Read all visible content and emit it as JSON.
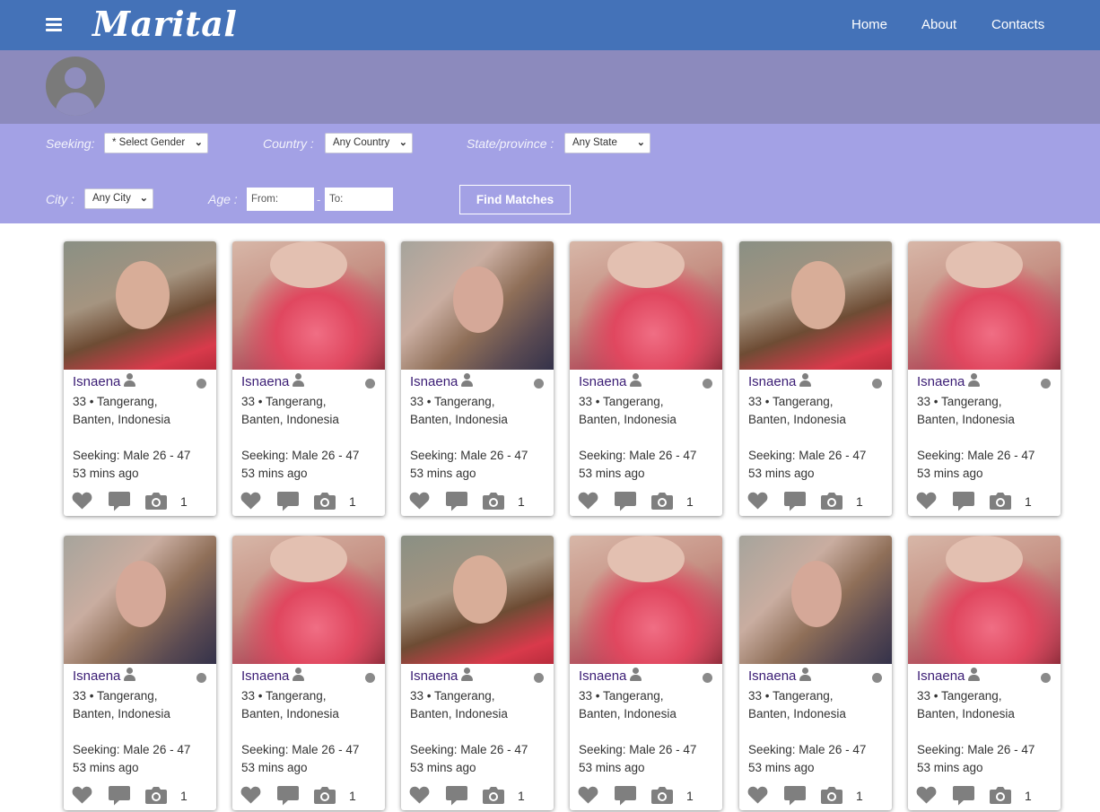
{
  "app": {
    "logo": "Marital",
    "nav": [
      {
        "label": "Home"
      },
      {
        "label": "About"
      },
      {
        "label": "Contacts"
      }
    ]
  },
  "filters": {
    "seeking_label": "Seeking:",
    "gender_value": "* Select Gender",
    "country_label": "Country :",
    "country_value": "Any Country",
    "state_label": "State/province :",
    "state_value": "Any State",
    "city_label": "City :",
    "city_value": "Any City",
    "age_label": "Age :",
    "age_from_placeholder": "From:",
    "age_to_placeholder": "To:",
    "age_separator": "-",
    "find_button": "Find Matches"
  },
  "profiles": [
    {
      "name": "Isnaena",
      "location_line1": "33 • Tangerang,",
      "location_line2": "Banten, Indonesia",
      "seeking_label": "Seeking:",
      "seeking_value": " Male 26 - 47",
      "last_seen": "53 mins ago",
      "photo_count": "1",
      "photo_style": "smile"
    },
    {
      "name": "Isnaena",
      "location_line1": "33 • Tangerang,",
      "location_line2": "Banten, Indonesia",
      "seeking_label": "Seeking:",
      "seeking_value": " Male 26 - 47",
      "last_seen": "53 mins ago",
      "photo_count": "1",
      "photo_style": "flowers"
    },
    {
      "name": "Isnaena",
      "location_line1": "33 • Tangerang,",
      "location_line2": "Banten, Indonesia",
      "seeking_label": "Seeking:",
      "seeking_value": " Male 26 - 47",
      "last_seen": "53 mins ago",
      "photo_count": "1",
      "photo_style": "profile"
    },
    {
      "name": "Isnaena",
      "location_line1": "33 • Tangerang,",
      "location_line2": "Banten, Indonesia",
      "seeking_label": "Seeking:",
      "seeking_value": " Male 26 - 47",
      "last_seen": "53 mins ago",
      "photo_count": "1",
      "photo_style": "flowers"
    },
    {
      "name": "Isnaena",
      "location_line1": "33 • Tangerang,",
      "location_line2": "Banten, Indonesia",
      "seeking_label": "Seeking:",
      "seeking_value": " Male 26 - 47",
      "last_seen": "53 mins ago",
      "photo_count": "1",
      "photo_style": "smile"
    },
    {
      "name": "Isnaena",
      "location_line1": "33 • Tangerang,",
      "location_line2": "Banten, Indonesia",
      "seeking_label": "Seeking:",
      "seeking_value": " Male 26 - 47",
      "last_seen": "53 mins ago",
      "photo_count": "1",
      "photo_style": "flowers"
    },
    {
      "name": "Isnaena",
      "location_line1": "33 • Tangerang,",
      "location_line2": "Banten, Indonesia",
      "seeking_label": "Seeking:",
      "seeking_value": " Male 26 - 47",
      "last_seen": "53 mins ago",
      "photo_count": "1",
      "photo_style": "profile"
    },
    {
      "name": "Isnaena",
      "location_line1": "33 • Tangerang,",
      "location_line2": "Banten, Indonesia",
      "seeking_label": "Seeking:",
      "seeking_value": " Male 26 - 47",
      "last_seen": "53 mins ago",
      "photo_count": "1",
      "photo_style": "flowers"
    },
    {
      "name": "Isnaena",
      "location_line1": "33 • Tangerang,",
      "location_line2": "Banten, Indonesia",
      "seeking_label": "Seeking:",
      "seeking_value": " Male 26 - 47",
      "last_seen": "53 mins ago",
      "photo_count": "1",
      "photo_style": "smile"
    },
    {
      "name": "Isnaena",
      "location_line1": "33 • Tangerang,",
      "location_line2": "Banten, Indonesia",
      "seeking_label": "Seeking:",
      "seeking_value": " Male 26 - 47",
      "last_seen": "53 mins ago",
      "photo_count": "1",
      "photo_style": "flowers"
    },
    {
      "name": "Isnaena",
      "location_line1": "33 • Tangerang,",
      "location_line2": "Banten, Indonesia",
      "seeking_label": "Seeking:",
      "seeking_value": " Male 26 - 47",
      "last_seen": "53 mins ago",
      "photo_count": "1",
      "photo_style": "profile"
    },
    {
      "name": "Isnaena",
      "location_line1": "33 • Tangerang,",
      "location_line2": "Banten, Indonesia",
      "seeking_label": "Seeking:",
      "seeking_value": " Male 26 - 47",
      "last_seen": "53 mins ago",
      "photo_count": "1",
      "photo_style": "flowers"
    }
  ],
  "icons": {
    "menu": "hamburger-menu-icon",
    "avatar": "user-avatar-icon",
    "name_badge": "user-icon",
    "status": "online-status-dot",
    "like": "heart-icon",
    "message": "chat-bubble-icon",
    "photos": "camera-icon"
  },
  "colors": {
    "header": "#4472b8",
    "profile_bar": "#8c8abd",
    "filter_bar": "#a3a1e5",
    "name": "#3a1c74",
    "icon_gray": "#7f7f7f"
  }
}
